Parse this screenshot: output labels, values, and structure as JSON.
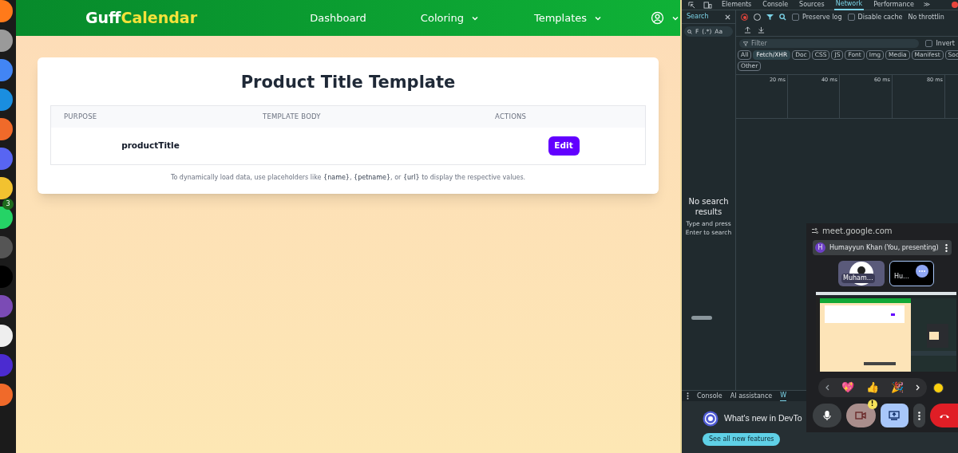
{
  "dock": {
    "badge": "3"
  },
  "app": {
    "brand": {
      "first": "Guff",
      "second": "Calendar"
    },
    "nav": [
      {
        "label": "Dashboard",
        "dropdown": false
      },
      {
        "label": "Coloring",
        "dropdown": true
      },
      {
        "label": "Templates",
        "dropdown": true
      }
    ],
    "page_title": "Product Title Template",
    "table": {
      "columns": [
        "PURPOSE",
        "TEMPLATE BODY",
        "ACTIONS"
      ],
      "rows": [
        {
          "purpose": "productTitle",
          "action": "Edit"
        }
      ]
    },
    "note": "To dynamically load data, use placeholders like **{name}**, **{petname}**, or **{url}** to display the respective values."
  },
  "devtools": {
    "tabs": [
      {
        "label": "Elements",
        "selected": false
      },
      {
        "label": "Console",
        "selected": false
      },
      {
        "label": "Sources",
        "selected": false
      },
      {
        "label": "Network",
        "selected": true
      },
      {
        "label": "Performance",
        "selected": false
      }
    ],
    "more": "≫",
    "search_panel": {
      "title": "Search",
      "options": [
        "F",
        "(.*)",
        "Aa"
      ],
      "empty_title": "No search results",
      "empty_hint": "Type and press Enter to search"
    },
    "preserve_log": {
      "label": "Preserve log",
      "checked": false
    },
    "disable_cache": {
      "label": "Disable cache",
      "checked": false
    },
    "throttling": "No throttlin",
    "filter": {
      "placeholder": "Filter"
    },
    "invert": {
      "label": "Invert",
      "checked": false
    },
    "type_filters": [
      {
        "label": "All",
        "selected": false
      },
      {
        "label": "Fetch/XHR",
        "selected": true
      },
      {
        "label": "Doc",
        "selected": false
      },
      {
        "label": "CSS",
        "selected": false
      },
      {
        "label": "JS",
        "selected": false
      },
      {
        "label": "Font",
        "selected": false
      },
      {
        "label": "Img",
        "selected": false
      },
      {
        "label": "Media",
        "selected": false
      },
      {
        "label": "Manifest",
        "selected": false
      },
      {
        "label": "Soc",
        "selected": false
      },
      {
        "label": "Other",
        "selected": false
      }
    ],
    "timeline_ticks": [
      "20 ms",
      "40 ms",
      "60 ms",
      "80 ms"
    ],
    "drawer_tabs": [
      {
        "label": "Console",
        "selected": false
      },
      {
        "label": "AI assistance",
        "selected": false
      },
      {
        "label": "W",
        "selected": true
      }
    ],
    "whats_new": {
      "title": "What's new in DevTo",
      "button": "See all new features"
    }
  },
  "meet": {
    "url": "meet.google.com",
    "presenter": {
      "initial": "H",
      "name": "Humayyun Khan (You, presenting)"
    },
    "tiles": [
      {
        "label": "Muham…",
        "kind": "avatar"
      },
      {
        "label": "Hu…",
        "kind": "self"
      }
    ],
    "reactions": [
      "💖",
      "👍",
      "🎉"
    ],
    "camera_warning": "!"
  }
}
